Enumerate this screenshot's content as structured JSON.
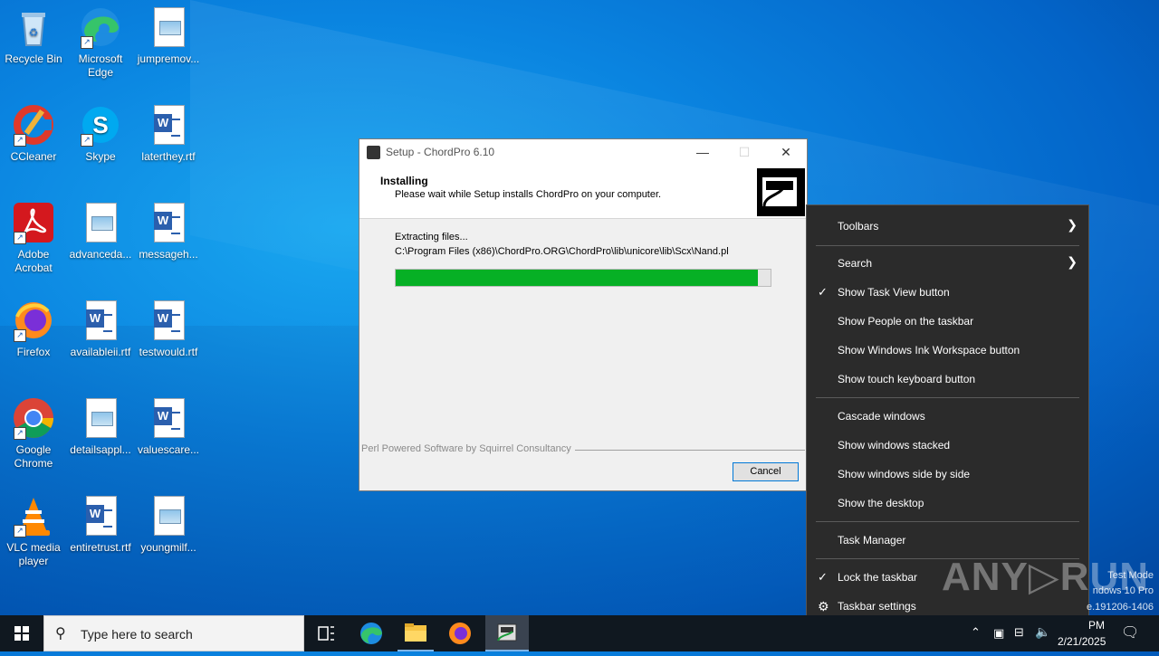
{
  "desktop": {
    "icons": [
      {
        "label": "Recycle Bin"
      },
      {
        "label": "Microsoft Edge"
      },
      {
        "label": "jumpremov..."
      },
      {
        "label": "CCleaner"
      },
      {
        "label": "Skype"
      },
      {
        "label": "laterthey.rtf"
      },
      {
        "label": "Adobe Acrobat"
      },
      {
        "label": "advanceda..."
      },
      {
        "label": "messageh..."
      },
      {
        "label": "Firefox"
      },
      {
        "label": "availableii.rtf"
      },
      {
        "label": "testwould.rtf"
      },
      {
        "label": "Google Chrome"
      },
      {
        "label": "detailsappl..."
      },
      {
        "label": "valuescare..."
      },
      {
        "label": "VLC media player"
      },
      {
        "label": "entiretrust.rtf"
      },
      {
        "label": "youngmilf..."
      }
    ]
  },
  "setup": {
    "title": "Setup - ChordPro 6.10",
    "minimize": "—",
    "maximize": "☐",
    "close": "✕",
    "header_title": "Installing",
    "header_subtitle": "Please wait while Setup installs ChordPro on your computer.",
    "status": "Extracting files...",
    "file_path": "C:\\Program Files (x86)\\ChordPro.ORG\\ChordPro\\lib\\unicore\\lib\\Scx\\Nand.pl",
    "progress": 0.965,
    "branding": "Perl Powered Software by Squirrel Consultancy",
    "cancel_label": "Cancel"
  },
  "context_menu": {
    "items": [
      {
        "label": "Toolbars",
        "checked": false,
        "submenu": true
      },
      {
        "label": "Search",
        "checked": false,
        "submenu": true
      },
      {
        "label": "Show Task View button",
        "checked": true,
        "submenu": false
      },
      {
        "label": "Show People on the taskbar",
        "checked": false,
        "submenu": false
      },
      {
        "label": "Show Windows Ink Workspace button",
        "checked": false,
        "submenu": false
      },
      {
        "label": "Show touch keyboard button",
        "checked": false,
        "submenu": false
      },
      {
        "label": "Cascade windows",
        "checked": false,
        "submenu": false
      },
      {
        "label": "Show windows stacked",
        "checked": false,
        "submenu": false
      },
      {
        "label": "Show windows side by side",
        "checked": false,
        "submenu": false
      },
      {
        "label": "Show the desktop",
        "checked": false,
        "submenu": false
      },
      {
        "label": "Task Manager",
        "checked": false,
        "submenu": false
      },
      {
        "label": "Lock the taskbar",
        "checked": true,
        "submenu": false
      },
      {
        "label": "Taskbar settings",
        "checked": false,
        "submenu": false
      }
    ]
  },
  "watermark": {
    "line1": "Test Mode",
    "line2": "ndows 10 Pro",
    "line3": "e.191206-1406",
    "brand": "ANY▷RUN"
  },
  "taskbar": {
    "search_placeholder": "Type here to search",
    "time": "PM",
    "date": "2/21/2025"
  },
  "colors": {
    "progress": "#06b025",
    "menu_bg": "#2b2b2b",
    "taskbar_bg": "#101820"
  }
}
